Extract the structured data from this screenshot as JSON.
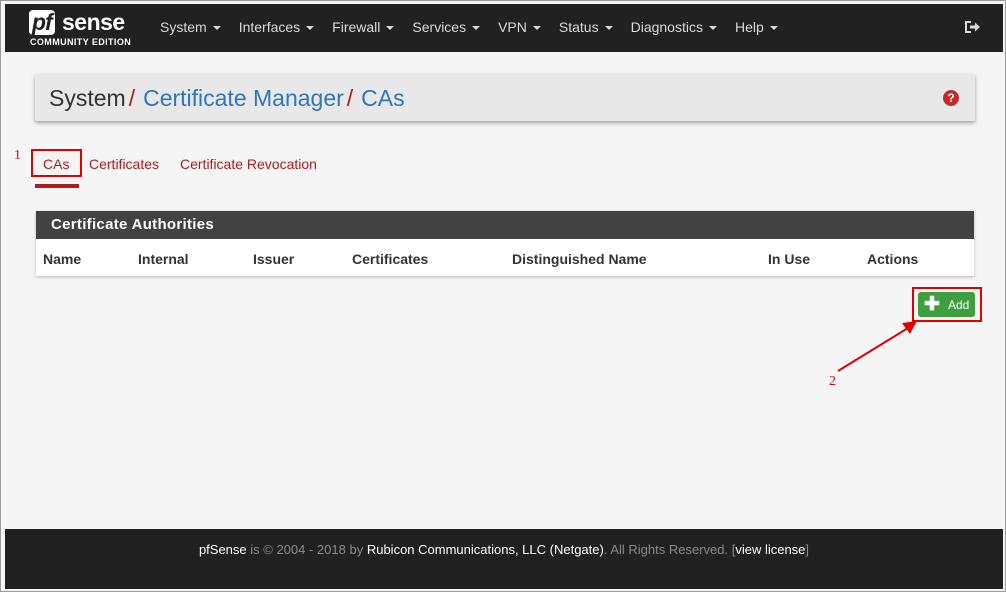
{
  "brand": {
    "logo_pf": "pf",
    "logo_sense": "sense",
    "logo_sub": "COMMUNITY EDITION"
  },
  "nav": {
    "items": [
      {
        "label": "System"
      },
      {
        "label": "Interfaces"
      },
      {
        "label": "Firewall"
      },
      {
        "label": "Services"
      },
      {
        "label": "VPN"
      },
      {
        "label": "Status"
      },
      {
        "label": "Diagnostics"
      },
      {
        "label": "Help"
      }
    ],
    "logout_icon": "sign-out-icon"
  },
  "breadcrumb": {
    "system": "System",
    "sep": "/",
    "cert_manager": "Certificate Manager",
    "cas": "CAs",
    "help_icon": "question-circle-icon"
  },
  "tabs": [
    {
      "label": "CAs",
      "active": true
    },
    {
      "label": "Certificates",
      "active": false
    },
    {
      "label": "Certificate Revocation",
      "active": false
    }
  ],
  "panel": {
    "title": "Certificate Authorities",
    "columns": [
      "Name",
      "Internal",
      "Issuer",
      "Certificates",
      "Distinguished Name",
      "In Use",
      "Actions"
    ]
  },
  "add_button": {
    "label": "Add",
    "icon": "plus-icon",
    "color": "#3f9e3f"
  },
  "annotations": {
    "step1": "1",
    "step2": "2"
  },
  "footer": {
    "product": "pfSense",
    "copyright": "is © 2004 - 2018 by",
    "company": "Rubicon Communications, LLC (Netgate)",
    "rights": ". All Rights Reserved. [",
    "view_license": "view license",
    "close_bracket": "]"
  },
  "colors": {
    "navbar": "#212121",
    "accent_red": "#b01c1c",
    "link_blue": "#2e77b8",
    "panel_header": "#424242"
  }
}
